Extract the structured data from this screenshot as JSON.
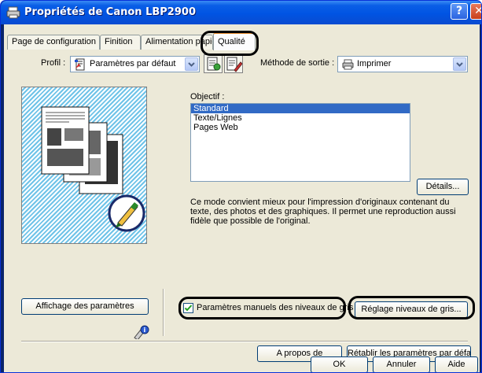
{
  "window": {
    "title": "Propriétés de Canon LBP2900"
  },
  "titlebar_buttons": {
    "help": "?",
    "close": "✕"
  },
  "tabs": [
    {
      "label": "Page de configuration"
    },
    {
      "label": "Finition"
    },
    {
      "label": "Alimentation papier"
    },
    {
      "label": "Qualité"
    }
  ],
  "profile": {
    "label": "Profil :",
    "value": "Paramètres par défaut"
  },
  "output": {
    "label": "Méthode de sortie :",
    "value": "Imprimer"
  },
  "objective": {
    "label": "Objectif :",
    "items": [
      "Standard",
      "Texte/Lignes",
      "Pages Web"
    ],
    "selected": "Standard"
  },
  "details_button": "Détails...",
  "description": "Ce mode convient mieux pour l'impression d'originaux contenant du texte, des photos et des graphiques. Il permet une reproduction aussi fidèle que possible de l'original.",
  "show_settings_button": "Affichage des paramètres",
  "manual_gray": {
    "label": "Paramètres manuels des niveaux de gris",
    "checked": true
  },
  "gray_adjust_button": "Réglage niveaux de gris...",
  "about_button": "A propos de",
  "restore_defaults_button": "Rétablir les paramètres par défaut",
  "footer": {
    "ok": "OK",
    "cancel": "Annuler",
    "help": "Aide"
  },
  "colors": {
    "titlebar": "#0054e3",
    "selection": "#316ac5",
    "dialog_bg": "#ece9d8",
    "tab_accent": "#e68b2c"
  },
  "icons": [
    "printer-icon",
    "document-settings-icon",
    "pencil-icon",
    "info-icon"
  ]
}
